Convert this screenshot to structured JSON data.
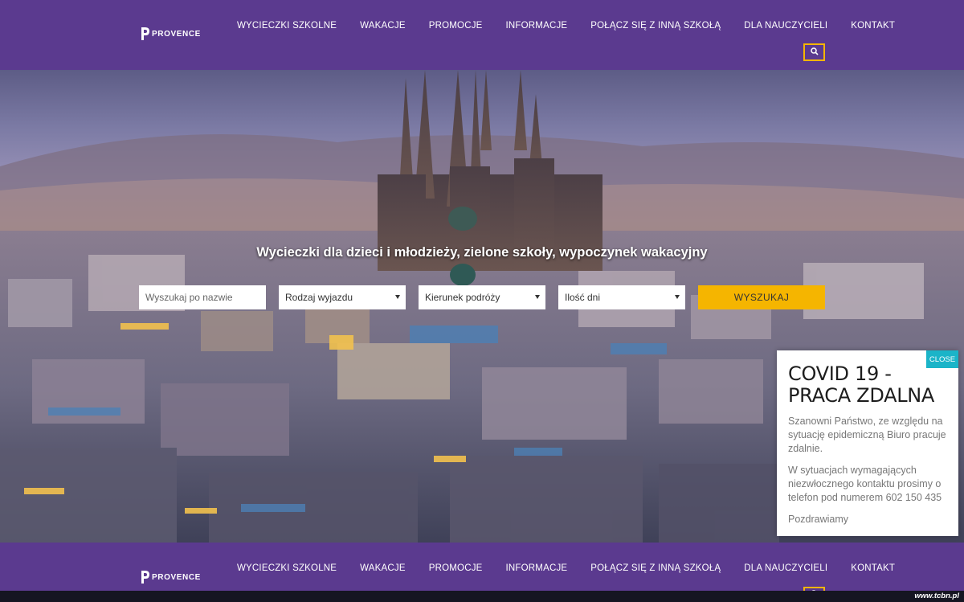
{
  "header": {
    "logo_text": "PROVENCE",
    "nav": [
      {
        "label": "WYCIECZKI SZKOLNE"
      },
      {
        "label": "WAKACJE"
      },
      {
        "label": "PROMOCJE"
      },
      {
        "label": "INFORMACJE"
      },
      {
        "label": "POŁĄCZ SIĘ Z INNĄ SZKOŁĄ"
      },
      {
        "label": "DLA NAUCZYCIELI"
      },
      {
        "label": "KONTAKT"
      }
    ],
    "search_icon": "search-icon"
  },
  "hero": {
    "title": "Wycieczki dla dzieci i młodzieży, zielone szkoły, wypoczynek wakacyjny",
    "search": {
      "name_placeholder": "Wyszukaj po nazwie",
      "trip_type": "Rodzaj wyjazdu",
      "direction": "Kierunek podróży",
      "days": "Ilość dni",
      "submit_label": "WYSZUKAJ"
    }
  },
  "popup": {
    "close_label": "CLOSE",
    "title": "COVID 19 - PRACA ZDALNA",
    "paragraph1": "Szanowni Państwo, ze względu na sytuację epidemiczną Biuro pracuje zdalnie.",
    "paragraph2": "W sytuacjach wymagających niezwłocznego kontaktu prosimy o telefon pod numerem 602 150 435",
    "paragraph3": "Pozdrawiamy"
  },
  "sticky_header": {
    "logo_text": "PROVENCE",
    "nav": [
      {
        "label": "WYCIECZKI SZKOLNE"
      },
      {
        "label": "WAKACJE"
      },
      {
        "label": "PROMOCJE"
      },
      {
        "label": "INFORMACJE"
      },
      {
        "label": "POŁĄCZ SIĘ Z INNĄ SZKOŁĄ"
      },
      {
        "label": "DLA NAUCZYCIELI"
      },
      {
        "label": "KONTAKT"
      }
    ]
  },
  "watermark": "www.tcbn.pl",
  "colors": {
    "brand_purple": "#5b3a8f",
    "accent_yellow": "#f5b500",
    "close_teal": "#1bb4c8"
  }
}
